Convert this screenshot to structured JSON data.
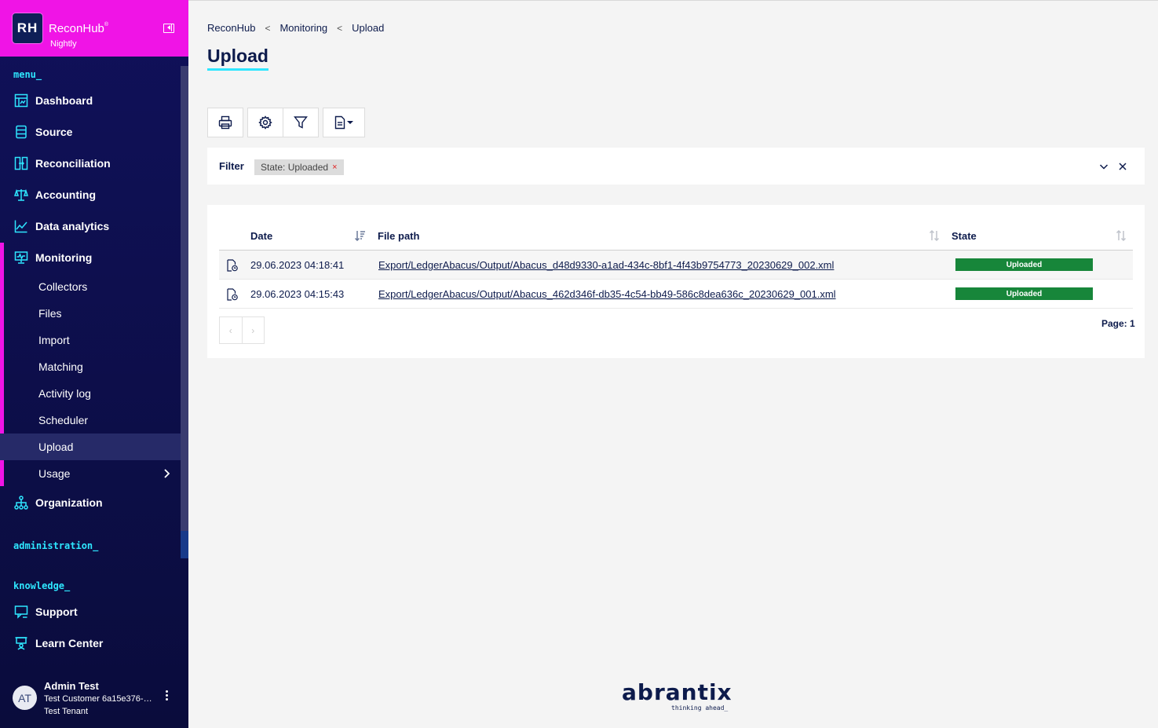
{
  "brand": {
    "logo": "RH",
    "name": "ReconHub",
    "reg": "®",
    "subtitle": "Nightly"
  },
  "sidebar": {
    "menu_label": "menu_",
    "items": [
      {
        "label": "Dashboard",
        "icon": "dashboard-icon"
      },
      {
        "label": "Source",
        "icon": "database-icon"
      },
      {
        "label": "Reconciliation",
        "icon": "reconciliation-icon"
      },
      {
        "label": "Accounting",
        "icon": "scale-icon"
      },
      {
        "label": "Data analytics",
        "icon": "chart-icon"
      },
      {
        "label": "Monitoring",
        "icon": "monitor-icon"
      }
    ],
    "monitoring_sub": [
      {
        "label": "Collectors"
      },
      {
        "label": "Files"
      },
      {
        "label": "Import"
      },
      {
        "label": "Matching"
      },
      {
        "label": "Activity log"
      },
      {
        "label": "Scheduler"
      },
      {
        "label": "Upload"
      },
      {
        "label": "Usage"
      }
    ],
    "organization": {
      "label": "Organization",
      "icon": "org-icon"
    },
    "admin_label": "administration_",
    "knowledge_label": "knowledge_",
    "knowledge_items": [
      {
        "label": "Support",
        "icon": "support-icon"
      },
      {
        "label": "Learn Center",
        "icon": "learn-icon"
      }
    ],
    "user": {
      "initials": "AT",
      "name": "Admin Test",
      "customer": "Test Customer 6a15e376-a...",
      "tenant": "Test Tenant"
    }
  },
  "breadcrumb": [
    "ReconHub",
    "Monitoring",
    "Upload"
  ],
  "page_title": "Upload",
  "filter": {
    "label": "Filter",
    "chip": "State: Uploaded",
    "chip_remove": "×"
  },
  "table": {
    "columns": [
      "Date",
      "File path",
      "State"
    ],
    "rows": [
      {
        "date": "29.06.2023 04:18:41",
        "path": "Export/LedgerAbacus/Output/Abacus_d48d9330-a1ad-434c-8bf1-4f43b9754773_20230629_002.xml",
        "state": "Uploaded"
      },
      {
        "date": "29.06.2023 04:15:43",
        "path": "Export/LedgerAbacus/Output/Abacus_462d346f-db35-4c54-bb49-586c8dea636c_20230629_001.xml",
        "state": "Uploaded"
      }
    ],
    "pager": {
      "prev": "‹",
      "next": "›"
    },
    "page_info": "Page: 1"
  },
  "footer": {
    "logo": "abrantix",
    "tagline": "thinking ahead_"
  },
  "colors": {
    "accent_magenta": "#f014e6",
    "accent_cyan": "#2ee6ff",
    "navy": "#0d1b4c",
    "uploaded_green": "#17863a"
  }
}
